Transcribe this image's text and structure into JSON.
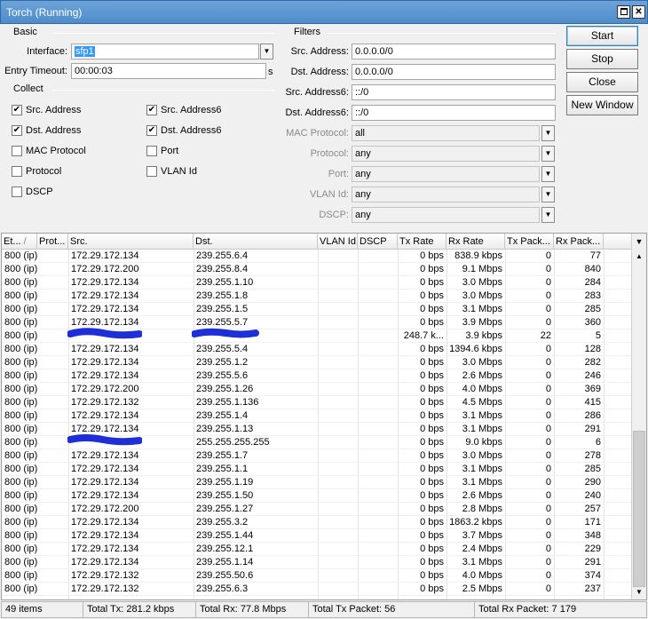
{
  "window": {
    "title": "Torch (Running)"
  },
  "basic": {
    "title": "Basic",
    "interface_label": "Interface:",
    "interface_value": "sfp1",
    "entry_timeout_label": "Entry Timeout:",
    "entry_timeout_value": "00:00:03",
    "entry_timeout_unit": "s"
  },
  "collect": {
    "title": "Collect",
    "items": [
      {
        "label": "Src. Address",
        "mark": "✔"
      },
      {
        "label": "Dst. Address",
        "mark": "✔"
      },
      {
        "label": "MAC Protocol",
        "mark": ""
      },
      {
        "label": "Protocol",
        "mark": ""
      },
      {
        "label": "DSCP",
        "mark": ""
      },
      {
        "label": "Src. Address6",
        "mark": "✔"
      },
      {
        "label": "Dst. Address6",
        "mark": "✔"
      },
      {
        "label": "Port",
        "mark": ""
      },
      {
        "label": "VLAN Id",
        "mark": ""
      }
    ]
  },
  "filters": {
    "title": "Filters",
    "items": [
      {
        "label": "Src. Address:",
        "value": "0.0.0.0/0"
      },
      {
        "label": "Dst. Address:",
        "value": "0.0.0.0/0"
      },
      {
        "label": "Src. Address6:",
        "value": "::/0"
      },
      {
        "label": "Dst. Address6:",
        "value": "::/0"
      },
      {
        "label": "MAC Protocol:",
        "value": "all"
      },
      {
        "label": "Protocol:",
        "value": "any"
      },
      {
        "label": "Port:",
        "value": "any"
      },
      {
        "label": "VLAN Id:",
        "value": "any"
      },
      {
        "label": "DSCP:",
        "value": "any"
      }
    ]
  },
  "buttons": {
    "start": "Start",
    "stop": "Stop",
    "close": "Close",
    "new_window": "New Window"
  },
  "table": {
    "headers": [
      "Et...",
      "Prot...",
      "Src.",
      "Dst.",
      "VLAN Id",
      "DSCP",
      "Tx Rate",
      "Rx Rate",
      "Tx Pack...",
      "Rx Pack..."
    ],
    "rows": [
      [
        "800 (ip)",
        "",
        "172.29.172.134",
        "239.255.6.4",
        "",
        "",
        "0 bps",
        "838.9 kbps",
        "0",
        "77"
      ],
      [
        "800 (ip)",
        "",
        "172.29.172.200",
        "239.255.8.4",
        "",
        "",
        "0 bps",
        "9.1 Mbps",
        "0",
        "840"
      ],
      [
        "800 (ip)",
        "",
        "172.29.172.134",
        "239.255.1.10",
        "",
        "",
        "0 bps",
        "3.0 Mbps",
        "0",
        "284"
      ],
      [
        "800 (ip)",
        "",
        "172.29.172.134",
        "239.255.1.8",
        "",
        "",
        "0 bps",
        "3.0 Mbps",
        "0",
        "283"
      ],
      [
        "800 (ip)",
        "",
        "172.29.172.134",
        "239.255.1.5",
        "",
        "",
        "0 bps",
        "3.1 Mbps",
        "0",
        "285"
      ],
      [
        "800 (ip)",
        "",
        "172.29.172.134",
        "239.255.5.7",
        "",
        "",
        "0 bps",
        "3.9 Mbps",
        "0",
        "360"
      ],
      [
        "800 (ip)",
        "",
        "",
        "",
        "",
        "",
        "248.7 k...",
        "3.9 kbps",
        "22",
        "5"
      ],
      [
        "800 (ip)",
        "",
        "172.29.172.134",
        "239.255.5.4",
        "",
        "",
        "0 bps",
        "1394.6 kbps",
        "0",
        "128"
      ],
      [
        "800 (ip)",
        "",
        "172.29.172.134",
        "239.255.1.2",
        "",
        "",
        "0 bps",
        "3.0 Mbps",
        "0",
        "282"
      ],
      [
        "800 (ip)",
        "",
        "172.29.172.134",
        "239.255.5.6",
        "",
        "",
        "0 bps",
        "2.6 Mbps",
        "0",
        "246"
      ],
      [
        "800 (ip)",
        "",
        "172.29.172.200",
        "239.255.1.26",
        "",
        "",
        "0 bps",
        "4.0 Mbps",
        "0",
        "369"
      ],
      [
        "800 (ip)",
        "",
        "172.29.172.132",
        "239.255.1.136",
        "",
        "",
        "0 bps",
        "4.5 Mbps",
        "0",
        "415"
      ],
      [
        "800 (ip)",
        "",
        "172.29.172.134",
        "239.255.1.4",
        "",
        "",
        "0 bps",
        "3.1 Mbps",
        "0",
        "286"
      ],
      [
        "800 (ip)",
        "",
        "172.29.172.134",
        "239.255.1.13",
        "",
        "",
        "0 bps",
        "3.1 Mbps",
        "0",
        "291"
      ],
      [
        "800 (ip)",
        "",
        "",
        "255.255.255.255",
        "",
        "",
        "0 bps",
        "9.0 kbps",
        "0",
        "6"
      ],
      [
        "800 (ip)",
        "",
        "172.29.172.134",
        "239.255.1.7",
        "",
        "",
        "0 bps",
        "3.0 Mbps",
        "0",
        "278"
      ],
      [
        "800 (ip)",
        "",
        "172.29.172.134",
        "239.255.1.1",
        "",
        "",
        "0 bps",
        "3.1 Mbps",
        "0",
        "285"
      ],
      [
        "800 (ip)",
        "",
        "172.29.172.134",
        "239.255.1.19",
        "",
        "",
        "0 bps",
        "3.1 Mbps",
        "0",
        "290"
      ],
      [
        "800 (ip)",
        "",
        "172.29.172.134",
        "239.255.1.50",
        "",
        "",
        "0 bps",
        "2.6 Mbps",
        "0",
        "240"
      ],
      [
        "800 (ip)",
        "",
        "172.29.172.200",
        "239.255.1.27",
        "",
        "",
        "0 bps",
        "2.8 Mbps",
        "0",
        "257"
      ],
      [
        "800 (ip)",
        "",
        "172.29.172.134",
        "239.255.3.2",
        "",
        "",
        "0 bps",
        "1863.2 kbps",
        "0",
        "171"
      ],
      [
        "800 (ip)",
        "",
        "172.29.172.134",
        "239.255.1.44",
        "",
        "",
        "0 bps",
        "3.7 Mbps",
        "0",
        "348"
      ],
      [
        "800 (ip)",
        "",
        "172.29.172.134",
        "239.255.12.1",
        "",
        "",
        "0 bps",
        "2.4 Mbps",
        "0",
        "229"
      ],
      [
        "800 (ip)",
        "",
        "172.29.172.134",
        "239.255.1.14",
        "",
        "",
        "0 bps",
        "3.1 Mbps",
        "0",
        "291"
      ],
      [
        "800 (ip)",
        "",
        "172.29.172.132",
        "239.255.50.6",
        "",
        "",
        "0 bps",
        "4.0 Mbps",
        "0",
        "374"
      ],
      [
        "800 (ip)",
        "",
        "172.29.172.132",
        "239.255.6.3",
        "",
        "",
        "0 bps",
        "2.5 Mbps",
        "0",
        "237"
      ]
    ]
  },
  "status": {
    "items_count": "49 items",
    "total_tx": "Total Tx: 281.2 kbps",
    "total_rx": "Total Rx: 77.8 Mbps",
    "total_tx_packet": "Total Tx Packet: 56",
    "total_rx_packet": "Total Rx Packet: 7 179"
  },
  "colors": {
    "title_bar": "#5b97d1",
    "redaction": "#1e2fd8",
    "selection": "#3399ff"
  },
  "icons": [
    "restore-icon",
    "close-icon",
    "dropdown-arrow-icon",
    "checkmark-icon",
    "column-menu-icon",
    "scroll-up-icon",
    "scroll-down-icon",
    "sort-indicator-icon"
  ]
}
